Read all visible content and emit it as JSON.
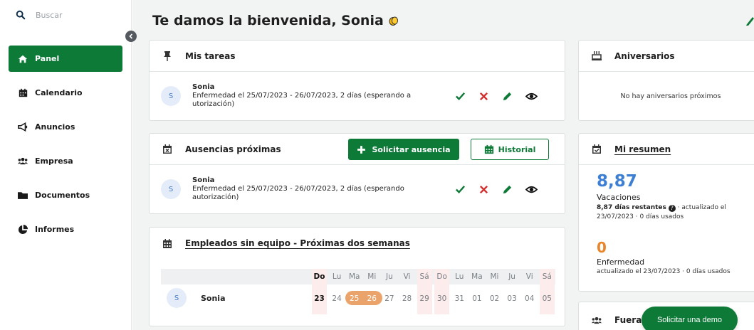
{
  "sidebar": {
    "search_placeholder": "Buscar",
    "items": [
      {
        "label": "Panel",
        "icon": "home-icon",
        "active": true
      },
      {
        "label": "Calendario",
        "icon": "calendar-icon"
      },
      {
        "label": "Anuncios",
        "icon": "megaphone-icon"
      },
      {
        "label": "Empresa",
        "icon": "users-icon"
      },
      {
        "label": "Documentos",
        "icon": "folder-icon"
      },
      {
        "label": "Informes",
        "icon": "chart-pie-icon"
      }
    ]
  },
  "header": {
    "welcome": "Te damos la bienvenida, Sonia"
  },
  "tasks": {
    "title": "Mis tareas",
    "item": {
      "avatar": "S",
      "name": "Sonia",
      "line1": "Enfermedad el 25/07/2023 - 26/07/2023, 2 días (esperando a",
      "line2": "utorización)"
    }
  },
  "absences": {
    "title": "Ausencias próximas",
    "request_button": "Solicitar ausencia",
    "history_button": "Historial",
    "item": {
      "avatar": "S",
      "name": "Sonia",
      "line1": "Enfermedad el 25/07/2023 - 26/07/2023, 2 días (esperando",
      "line2": "autorización)"
    }
  },
  "calendar": {
    "title": "Empleados sin equipo - Próximas dos semanas",
    "days": [
      "Do",
      "Lu",
      "Ma",
      "Mi",
      "Ju",
      "Vi",
      "Sá",
      "Do",
      "Lu",
      "Ma",
      "Mi",
      "Ju",
      "Vi",
      "Sá"
    ],
    "dates": [
      "23",
      "24",
      "25",
      "26",
      "27",
      "28",
      "29",
      "30",
      "31",
      "01",
      "02",
      "03",
      "04",
      "05"
    ],
    "weekend_index": [
      0,
      6,
      7,
      13
    ],
    "highlight_range": [
      2,
      3
    ],
    "employee": {
      "avatar": "S",
      "name": "Sonia"
    }
  },
  "anniversaries": {
    "title": "Aniversarios",
    "empty": "No hay aniversarios próximos"
  },
  "summary": {
    "title": "Mi resumen",
    "vacation_value": "8,87",
    "vacation_label": "Vacaciones",
    "vacation_detail_bold": "8,87 días restantes",
    "vacation_detail_rest": " · actualizado el",
    "vacation_detail_line2": "23/07/2023 · 0 días usados",
    "sick_value": "0",
    "sick_label": "Enfermedad",
    "sick_detail": "actualizado el 23/07/2023 · 0 días usados"
  },
  "away": {
    "title": "Fuera"
  },
  "demo_button": "Solicitar una demo",
  "colors": {
    "brand": "#0e7a38",
    "vacation": "#3d7fd3",
    "sick": "#e9862b",
    "range": "#eaa36a"
  }
}
